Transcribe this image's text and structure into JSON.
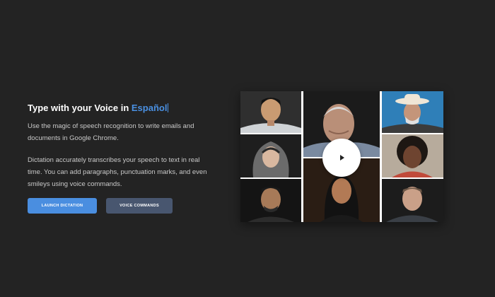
{
  "hero": {
    "headline_prefix": "Type with your Voice in ",
    "headline_language": "Español",
    "intro": "Use the magic of speech recognition to write emails and documents in Google Chrome.",
    "details": "Dictation accurately transcribes your speech to text in real time. You can add paragraphs, punctuation marks, and even smileys using voice commands."
  },
  "buttons": {
    "launch_label": "LAUNCH DICTATION",
    "commands_label": "VOICE COMMANDS"
  },
  "colors": {
    "background": "#232323",
    "accent": "#4a90e2",
    "primary_button": "#4a8ee0",
    "secondary_button": "#48566f"
  },
  "media": {
    "play_icon": "play-icon"
  }
}
